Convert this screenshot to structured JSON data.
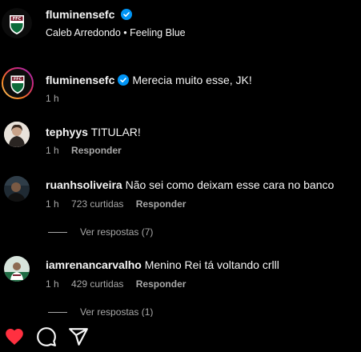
{
  "post": {
    "username": "fluminensefc",
    "subtitle": "Caleb Arredondo • Feeling Blue"
  },
  "comments": [
    {
      "username": "fluminensefc",
      "verified": true,
      "text": "Merecia muito esse, JK!",
      "time": "1 h"
    },
    {
      "username": "tephyys",
      "text": "TITULAR!",
      "time": "1 h",
      "reply_label": "Responder"
    },
    {
      "username": "ruanhsoliveira",
      "text": "Não sei como deixam esse cara no banco",
      "time": "1 h",
      "likes": "723 curtidas",
      "reply_label": "Responder",
      "view_replies": "Ver respostas (7)"
    },
    {
      "username": "iamrenancarvalho",
      "text": "Menino Rei tá voltando crlll",
      "time": "1 h",
      "likes": "429 curtidas",
      "reply_label": "Responder",
      "view_replies": "Ver respostas (1)"
    }
  ],
  "actions": {
    "like_icon": "heart-filled-icon",
    "comment_icon": "comment-icon",
    "share_icon": "share-icon"
  },
  "colors": {
    "background": "#000000",
    "text": "#f5f5f5",
    "muted": "#a8a8a8",
    "verified": "#0095f6",
    "like": "#ff3040",
    "club_maroon": "#7a1c2e",
    "club_green": "#0b6b3a"
  }
}
